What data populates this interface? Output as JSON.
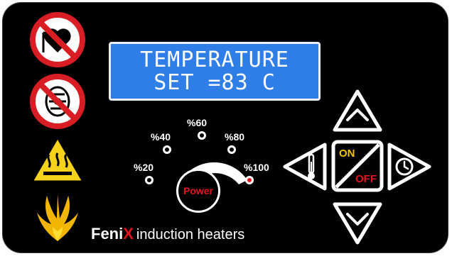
{
  "display": {
    "line1": "TEMPERATURE",
    "line2": "SET =83 C"
  },
  "power_levels": {
    "p20": "%20",
    "p40": "%40",
    "p60": "%60",
    "p80": "%80",
    "p100": "%100",
    "selected": "%100"
  },
  "power_knob_label": "Power",
  "controls": {
    "on_label": "ON",
    "off_label": "OFF"
  },
  "brand": {
    "name_part1": "Feni",
    "name_part2": "X",
    "tagline": "induction heaters"
  },
  "icons": [
    "no-pacemaker-icon",
    "no-metal-implant-icon",
    "hot-surface-warning-icon",
    "phoenix-logo-icon",
    "thermometer-icon",
    "timer-clock-icon",
    "arrow-up-icon",
    "arrow-down-icon"
  ],
  "colors": {
    "panel": "#000000",
    "lcd_background": "#2f7de6",
    "accent_red": "#e8141c",
    "on_yellow": "#f2c500",
    "warning_yellow": "#f7d21a"
  }
}
